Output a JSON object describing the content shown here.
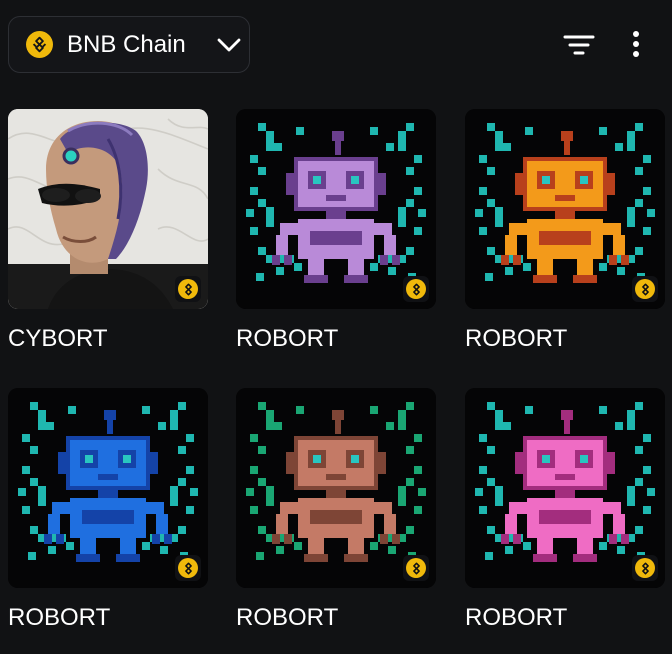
{
  "header": {
    "chain_label": "BNB Chain",
    "chain_icon": "bnb-chain-icon",
    "dropdown_icon": "chevron-down-icon",
    "filter_icon": "filter-icon",
    "more_icon": "more-vertical-icon"
  },
  "colors": {
    "background": "#111214",
    "bnb_yellow": "#F0B90B",
    "card_background": "#050506",
    "circuit_teal": "#1fb7b0"
  },
  "nfts": [
    {
      "name": "CYBORT",
      "kind": "portrait",
      "chain_badge": "bnb-chain-icon"
    },
    {
      "name": "ROBORT",
      "kind": "robot",
      "color": "#b98ad8",
      "dark": "#6a3f8e",
      "circuit": "#1fb7b0",
      "chain_badge": "bnb-chain-icon"
    },
    {
      "name": "ROBORT",
      "kind": "robot",
      "color": "#f39a1a",
      "dark": "#b8401c",
      "circuit": "#1fb7b0",
      "chain_badge": "bnb-chain-icon"
    },
    {
      "name": "ROBORT",
      "kind": "robot",
      "color": "#1f6fe0",
      "dark": "#1443a8",
      "circuit": "#1fb7b0",
      "chain_badge": "bnb-chain-icon"
    },
    {
      "name": "ROBORT",
      "kind": "robot",
      "color": "#c47a66",
      "dark": "#7e4536",
      "circuit": "#1aa673",
      "chain_badge": "bnb-chain-icon"
    },
    {
      "name": "ROBORT",
      "kind": "robot",
      "color": "#ef6cc4",
      "dark": "#a32d7e",
      "circuit": "#1fb7b0",
      "chain_badge": "bnb-chain-icon"
    }
  ]
}
